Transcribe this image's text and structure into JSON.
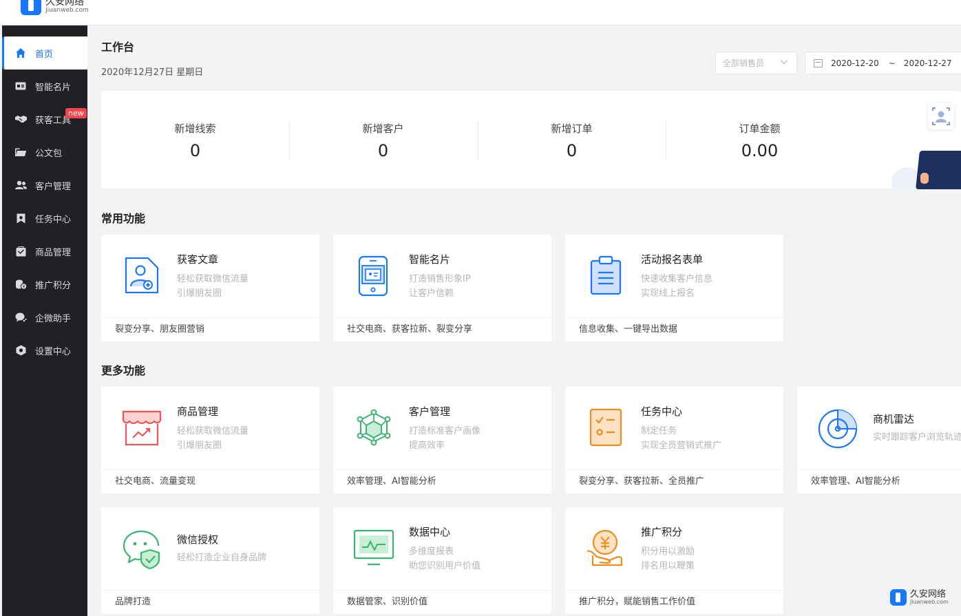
{
  "brand": {
    "name_cn": "久安网络",
    "name_en": "Jiuanweb.com"
  },
  "sidebar": {
    "items": [
      {
        "label": "首页",
        "icon": "home-icon",
        "active": true
      },
      {
        "label": "智能名片",
        "icon": "id-card-icon"
      },
      {
        "label": "获客工具",
        "icon": "handshake-icon",
        "badge": "new"
      },
      {
        "label": "公文包",
        "icon": "folder-icon"
      },
      {
        "label": "客户管理",
        "icon": "users-icon"
      },
      {
        "label": "任务中心",
        "icon": "bookmark-icon"
      },
      {
        "label": "商品管理",
        "icon": "goods-icon"
      },
      {
        "label": "推广积分",
        "icon": "coins-icon"
      },
      {
        "label": "企微助手",
        "icon": "chat-icon"
      },
      {
        "label": "设置中心",
        "icon": "settings-icon"
      }
    ]
  },
  "header": {
    "title": "工作台",
    "date": "2020年12月27日 星期日",
    "sales_select_placeholder": "全部销售员",
    "date_start": "2020-12-20",
    "date_sep": "~",
    "date_end": "2020-12-27"
  },
  "stats": [
    {
      "label": "新增线索",
      "value": "0"
    },
    {
      "label": "新增客户",
      "value": "0"
    },
    {
      "label": "新增订单",
      "value": "0"
    },
    {
      "label": "订单金额",
      "value": "0.00"
    }
  ],
  "common": {
    "title": "常用功能",
    "cards": [
      {
        "title": "获客文章",
        "desc1": "轻松获取微信流量",
        "desc2": "引爆朋友圈",
        "foot": "裂变分享、朋友圈营销",
        "icon": "article-user-icon"
      },
      {
        "title": "智能名片",
        "desc1": "打造销售形象IP",
        "desc2": "让客户信赖",
        "foot": "社交电商、获客拉新、裂变分享",
        "icon": "phone-card-icon"
      },
      {
        "title": "活动报名表单",
        "desc1": "快速收集客户信息",
        "desc2": "实现线上报名",
        "foot": "信息收集、一键导出数据",
        "icon": "clipboard-icon"
      }
    ]
  },
  "more": {
    "title": "更多功能",
    "cards": [
      {
        "title": "商品管理",
        "desc1": "轻松获取微信流量",
        "desc2": "引爆朋友圈",
        "foot": "社交电商、流量变现",
        "icon": "shop-icon"
      },
      {
        "title": "客户管理",
        "desc1": "打造标准客户画像",
        "desc2": "提高效率",
        "foot": "效率管理、AI智能分析",
        "icon": "cube-network-icon"
      },
      {
        "title": "任务中心",
        "desc1": "制定任务",
        "desc2": "实现全员营销式推广",
        "foot": "裂变分享、获客拉新、全员推广",
        "icon": "task-list-icon"
      },
      {
        "title": "商机雷达",
        "desc1": "实时跟踪客户浏览轨迹",
        "desc2": "",
        "foot": "效率管理、AI智能分析",
        "icon": "radar-icon"
      },
      {
        "title": "微信授权",
        "desc1": "轻松打造企业自身品牌",
        "desc2": "",
        "foot": "品牌打造",
        "icon": "wechat-shield-icon"
      },
      {
        "title": "数据中心",
        "desc1": "多维度报表",
        "desc2": "助您识别用户价值",
        "foot": "数据管家、识别价值",
        "icon": "monitor-chart-icon"
      },
      {
        "title": "推广积分",
        "desc1": "积分用以激励",
        "desc2": "排名用以鞭策",
        "foot": "推广积分，赋能销售工作价值",
        "icon": "yuan-coin-hand-icon"
      }
    ]
  },
  "colors": {
    "accent": "#1677ff",
    "sidebar_bg": "#1f2125",
    "new_badge": "#f5454a"
  }
}
